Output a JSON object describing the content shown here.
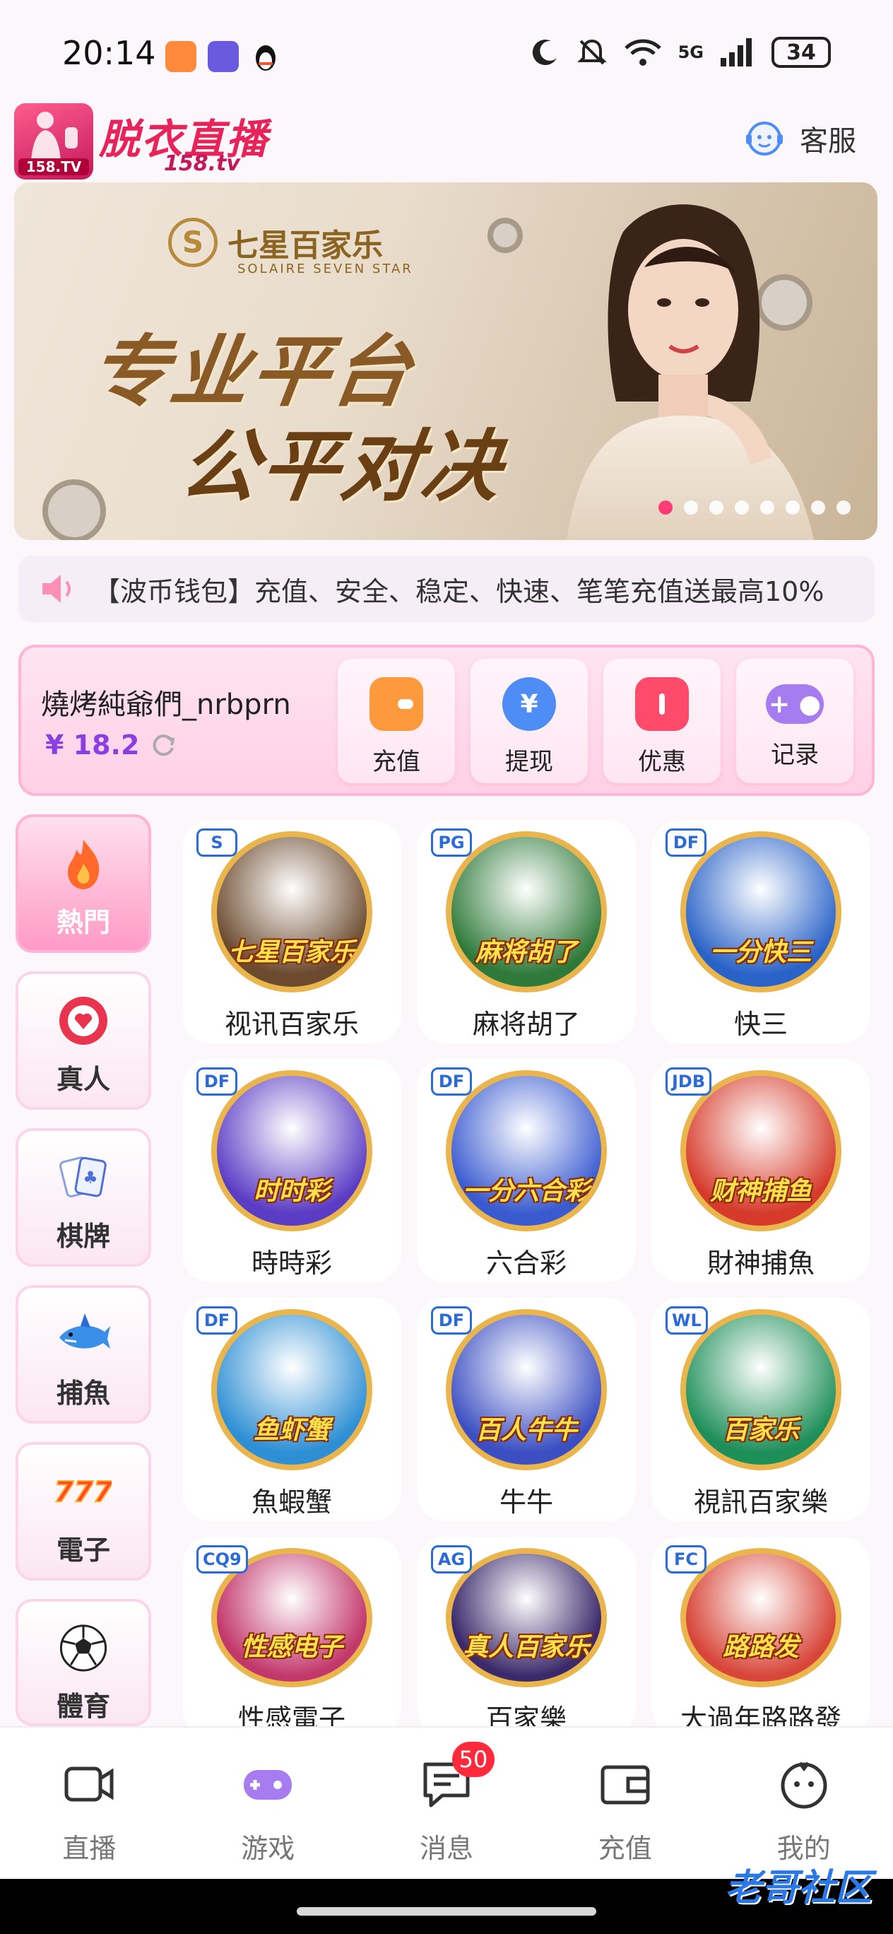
{
  "status_bar": {
    "time": "20:14",
    "network": "5G",
    "battery": "34",
    "app_icons": [
      "heart-app-icon",
      "vpn-shield-icon",
      "qq-penguin-icon"
    ],
    "right_icons": [
      "moon-icon",
      "mute-icon",
      "wifi-icon",
      "signal-icon"
    ]
  },
  "header": {
    "logo_title": "脱衣直播",
    "logo_badge": "158.TV",
    "logo_subtitle": "158.tv",
    "service_label": "客服"
  },
  "banner": {
    "brand_name": "七星百家乐",
    "brand_en": "SOLAIRE SEVEN STAR",
    "line1": "专业平台",
    "line2": "公平对决",
    "slide_count": 8,
    "active_slide": 0
  },
  "marquee": {
    "text": "【波币钱包】充值、安全、稳定、快速、笔笔充值送最高10%"
  },
  "user": {
    "name": "燒烤純爺們_nrbprn",
    "balance": "¥ 18.2"
  },
  "actions": [
    {
      "label": "充值",
      "icon": "wallet-icon",
      "color": "#ff9a3c"
    },
    {
      "label": "提现",
      "icon": "yuan-coin-icon",
      "color": "#4e8df5"
    },
    {
      "label": "优惠",
      "icon": "ticket-icon",
      "color": "#ff4a6b"
    },
    {
      "label": "记录",
      "icon": "gamepad-icon",
      "color": "#a77cf0"
    }
  ],
  "categories": [
    {
      "label": "熱門",
      "icon": "flame-icon",
      "active": true
    },
    {
      "label": "真人",
      "icon": "poker-chip-icon",
      "active": false
    },
    {
      "label": "棋牌",
      "icon": "playing-cards-icon",
      "active": false
    },
    {
      "label": "捕魚",
      "icon": "shark-icon",
      "active": false
    },
    {
      "label": "電子",
      "icon": "slot-777-icon",
      "active": false
    },
    {
      "label": "體育",
      "icon": "soccer-ball-icon",
      "active": false
    }
  ],
  "games": [
    {
      "label": "视讯百家乐",
      "caption": "七星百家乐",
      "provider": "S",
      "bg": "#6b4a2e"
    },
    {
      "label": "麻将胡了",
      "caption": "麻将胡了",
      "provider": "PG",
      "bg": "#2f7a3a"
    },
    {
      "label": "快三",
      "caption": "一分快三",
      "provider": "DF",
      "bg": "#2a63c8"
    },
    {
      "label": "時時彩",
      "caption": "时时彩",
      "provider": "DF",
      "bg": "#5b3cc4"
    },
    {
      "label": "六合彩",
      "caption": "一分六合彩",
      "provider": "DF",
      "bg": "#3a5bd0"
    },
    {
      "label": "財神捕魚",
      "caption": "财神捕鱼",
      "provider": "JDB",
      "bg": "#d63a2a"
    },
    {
      "label": "魚蝦蟹",
      "caption": "鱼虾蟹",
      "provider": "DF",
      "bg": "#2e8fd4"
    },
    {
      "label": "牛牛",
      "caption": "百人牛牛",
      "provider": "DF",
      "bg": "#3c4fc2"
    },
    {
      "label": "視訊百家樂",
      "caption": "百家乐",
      "provider": "WL",
      "bg": "#1f8f5a"
    },
    {
      "label": "性感電子",
      "caption": "性感电子",
      "provider": "CQ9",
      "bg": "#c2386b"
    },
    {
      "label": "百家樂",
      "caption": "真人百家乐",
      "provider": "AG",
      "bg": "#3b2a6b"
    },
    {
      "label": "大過年路路發",
      "caption": "路路发",
      "provider": "FC",
      "bg": "#d8463a"
    }
  ],
  "nav": [
    {
      "label": "直播",
      "icon": "video-camera-icon",
      "active": false
    },
    {
      "label": "游戏",
      "icon": "gamepad-icon",
      "active": true
    },
    {
      "label": "消息",
      "icon": "message-icon",
      "active": false,
      "badge": "50"
    },
    {
      "label": "充值",
      "icon": "wallet-icon",
      "active": false
    },
    {
      "label": "我的",
      "icon": "face-icon",
      "active": false
    }
  ],
  "watermark": "老哥社区"
}
